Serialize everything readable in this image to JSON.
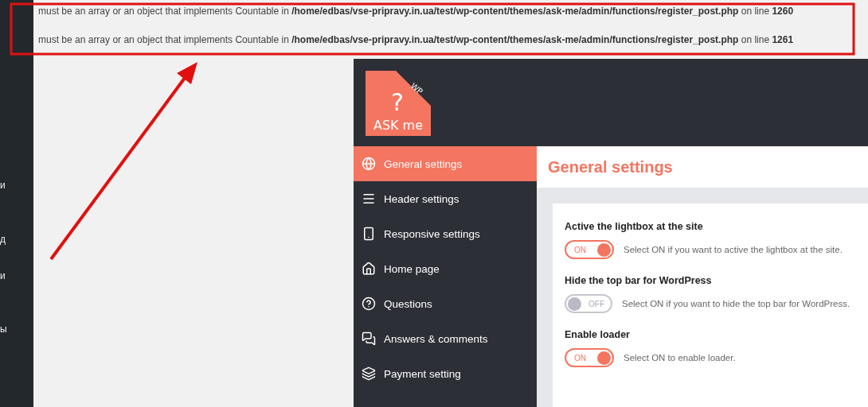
{
  "admin_sidebar": {
    "items": [
      "и",
      "д",
      "и",
      "ы"
    ]
  },
  "errors": [
    {
      "message": "must be an array or an object that implements Countable in **/home/edbas/vse-pripravy.in.ua/test/wp-content/themes/ask-me/admin/functions/register_post.php** on line **1260**"
    },
    {
      "message": "must be an array or an object that implements Countable in **/home/edbas/vse-pripravy.in.ua/test/wp-content/themes/ask-me/admin/functions/register_post.php** on line **1261**"
    }
  ],
  "logo": {
    "mark": "?",
    "name": "ASK me",
    "badge": "WP"
  },
  "nav": [
    {
      "label": "General settings",
      "selected": true
    },
    {
      "label": "Header settings",
      "selected": false
    },
    {
      "label": "Responsive settings",
      "selected": false
    },
    {
      "label": "Home page",
      "selected": false
    },
    {
      "label": "Questions",
      "selected": false
    },
    {
      "label": "Answers & comments",
      "selected": false
    },
    {
      "label": "Payment setting",
      "selected": false
    }
  ],
  "page_title": "General settings",
  "settings": [
    {
      "title": "Active the lightbox at the site",
      "on": true,
      "toggle_text": "ON",
      "description": "Select ON if you want to active the lightbox at the site."
    },
    {
      "title": "Hide the top bar for WordPress",
      "on": false,
      "toggle_text": "OFF",
      "description": "Select ON if you want to hide the top bar for WordPress."
    },
    {
      "title": "Enable loader",
      "on": true,
      "toggle_text": "ON",
      "description": "Select ON to enable loader."
    }
  ]
}
